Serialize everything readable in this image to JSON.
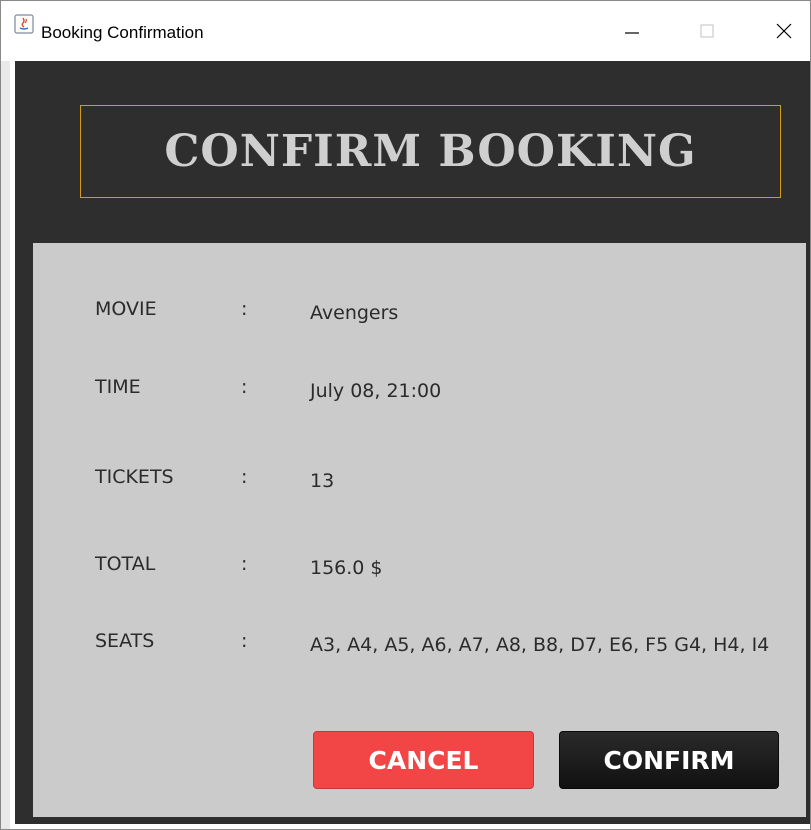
{
  "window": {
    "title": "Booking Confirmation",
    "icon": "java-app-icon",
    "controls": {
      "minimize": "minimize-icon",
      "maximize": "maximize-icon",
      "close": "close-icon"
    }
  },
  "header": {
    "title": "CONFIRM BOOKING"
  },
  "details": {
    "separator": ":",
    "rows": [
      {
        "label": "MOVIE",
        "value": "Avengers"
      },
      {
        "label": "TIME",
        "value": "July 08, 21:00"
      },
      {
        "label": "TICKETS",
        "value": "13"
      },
      {
        "label": "TOTAL",
        "value": "156.0 $"
      },
      {
        "label": "SEATS",
        "value": "A3, A4, A5, A6, A7, A8, B8, D7, E6, F5 G4, H4, I4"
      }
    ]
  },
  "actions": {
    "cancel_label": "CANCEL",
    "confirm_label": "CONFIRM"
  },
  "colors": {
    "dark_panel": "#2e2e2e",
    "info_panel": "#cbcbcb",
    "header_border": "#d49b19",
    "header_text": "#cfcfcf",
    "cancel_button": "#f24646",
    "confirm_button": "#1a1a1a"
  }
}
